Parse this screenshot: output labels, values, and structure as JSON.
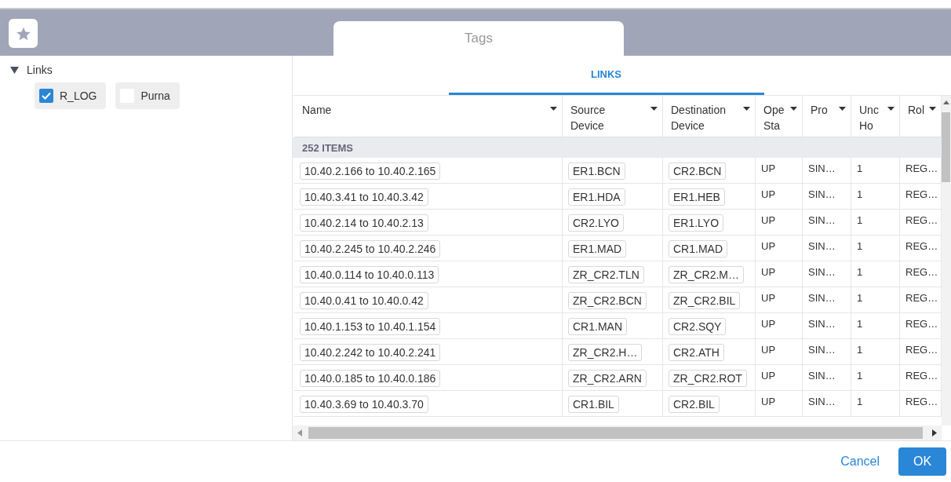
{
  "top_tab": {
    "label": "Tags",
    "selected": true
  },
  "tree": {
    "label": "Links",
    "expanded": true,
    "options": [
      {
        "label": "R_LOG",
        "checked": true
      },
      {
        "label": "Purna",
        "checked": false
      }
    ]
  },
  "subtabs": [
    {
      "label": "LINKS",
      "selected": true
    }
  ],
  "table": {
    "columns": [
      "Name",
      "Source Device",
      "Destination Device",
      "Ope Sta",
      "Pro",
      "Unc Ho",
      "Rol"
    ],
    "group_label": "252 ITEMS",
    "rows": [
      [
        "10.40.2.166 to 10.40.2.165",
        "ER1.BCN",
        "CR2.BCN",
        "UP",
        "SIN…",
        "1",
        "REG…"
      ],
      [
        "10.40.3.41 to 10.40.3.42",
        "ER1.HDA",
        "ER1.HEB",
        "UP",
        "SIN…",
        "1",
        "REG…"
      ],
      [
        "10.40.2.14 to 10.40.2.13",
        "CR2.LYO",
        "ER1.LYO",
        "UP",
        "SIN…",
        "1",
        "REG…"
      ],
      [
        "10.40.2.245 to 10.40.2.246",
        "ER1.MAD",
        "CR1.MAD",
        "UP",
        "SIN…",
        "1",
        "REG…"
      ],
      [
        "10.40.0.114 to 10.40.0.113",
        "ZR_CR2.TLN",
        "ZR_CR2.M…",
        "UP",
        "SIN…",
        "1",
        "REG…"
      ],
      [
        "10.40.0.41 to 10.40.0.42",
        "ZR_CR2.BCN",
        "ZR_CR2.BIL",
        "UP",
        "SIN…",
        "1",
        "REG…"
      ],
      [
        "10.40.1.153 to 10.40.1.154",
        "CR1.MAN",
        "CR2.SQY",
        "UP",
        "SIN…",
        "1",
        "REG…"
      ],
      [
        "10.40.2.242 to 10.40.2.241",
        "ZR_CR2.H…",
        "CR2.ATH",
        "UP",
        "SIN…",
        "1",
        "REG…"
      ],
      [
        "10.40.0.185 to 10.40.0.186",
        "ZR_CR2.ARN",
        "ZR_CR2.ROT",
        "UP",
        "SIN…",
        "1",
        "REG…"
      ],
      [
        "10.40.3.69 to 10.40.3.70",
        "CR1.BIL",
        "CR2.BIL",
        "UP",
        "SIN…",
        "1",
        "REG…"
      ]
    ]
  },
  "buttons": {
    "cancel": "Cancel",
    "ok": "OK"
  }
}
